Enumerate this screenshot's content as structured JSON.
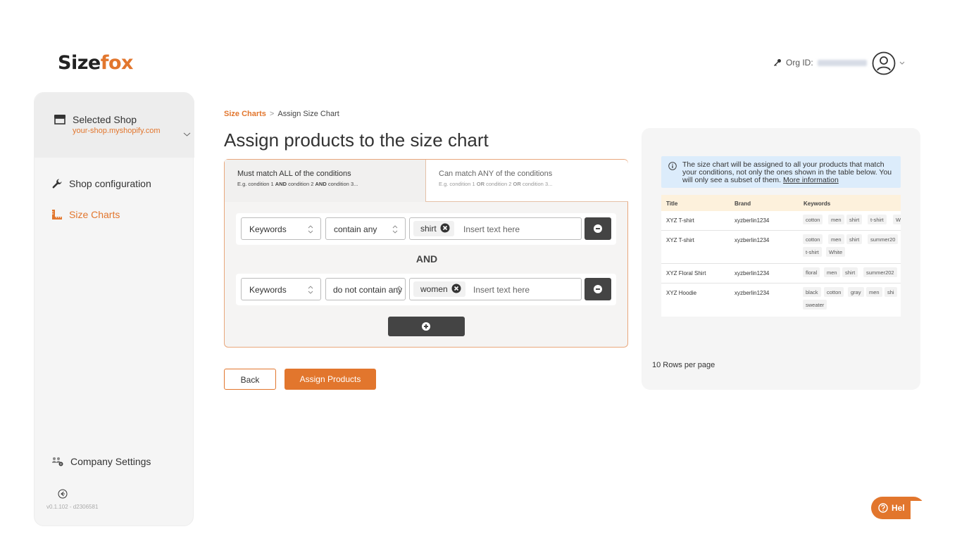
{
  "brand": {
    "logo_part1": "Size",
    "logo_part2": "fox",
    "accent": "#e2762d"
  },
  "header": {
    "org_label": "Org ID:"
  },
  "sidebar": {
    "shop_title": "Selected Shop",
    "shop_url": "your-shop.myshopify.com",
    "items": [
      {
        "label": "Shop configuration",
        "icon": "wrench-icon"
      },
      {
        "label": "Size Charts",
        "icon": "ruler-icon",
        "active": true
      }
    ],
    "company_settings": "Company Settings",
    "version": "v0.1.102 - d2306581"
  },
  "breadcrumb": {
    "root": "Size Charts",
    "separator": ">",
    "current": "Assign Size Chart"
  },
  "page_title": "Assign products to the size chart",
  "tabs": [
    {
      "title": "Must match ALL of the conditions",
      "sub_pre": "E.g. condition 1 ",
      "op": "AND",
      "sub_mid": " condition 2 ",
      "sub_end": " condition 3..."
    },
    {
      "title": "Can match ANY of the conditions",
      "sub_pre": "E.g. condition 1 ",
      "op": "OR",
      "sub_mid": " condition 2 ",
      "sub_end": " condition 3..."
    }
  ],
  "conditions": [
    {
      "field": "Keywords",
      "operator": "contain any",
      "tag": "shirt",
      "placeholder": "Insert text here"
    },
    {
      "field": "Keywords",
      "operator": "do not contain any",
      "tag": "women",
      "placeholder": "Insert text here"
    }
  ],
  "joiner": "AND",
  "buttons": {
    "back": "Back",
    "assign": "Assign Products"
  },
  "preview": {
    "info_text": "The size chart will be assigned to all your products that match your conditions, not only the ones shown in the table below. You will only see a subset of them.",
    "info_link": "More information",
    "columns": [
      "Title",
      "Brand",
      "Keywords"
    ],
    "rows": [
      {
        "title": "XYZ T-shirt",
        "brand": "xyzberlin1234",
        "keywords": [
          "cotton",
          "men",
          "shirt",
          "t-shirt",
          "W"
        ]
      },
      {
        "title": "XYZ T-shirt",
        "brand": "xyzberlin1234",
        "keywords": [
          "cotton",
          "men",
          "shirt",
          "summer20",
          "t-shirt",
          "White"
        ]
      },
      {
        "title": "XYZ Floral Shirt",
        "brand": "xyzberlin1234",
        "keywords": [
          "floral",
          "men",
          "shirt",
          "summer202"
        ]
      },
      {
        "title": "XYZ Hoodie",
        "brand": "xyzberlin1234",
        "keywords": [
          "black",
          "cotton",
          "gray",
          "men",
          "shi",
          "sweater"
        ]
      }
    ],
    "rows_per_page": "10 Rows per page"
  },
  "help": {
    "label": "Hel"
  }
}
